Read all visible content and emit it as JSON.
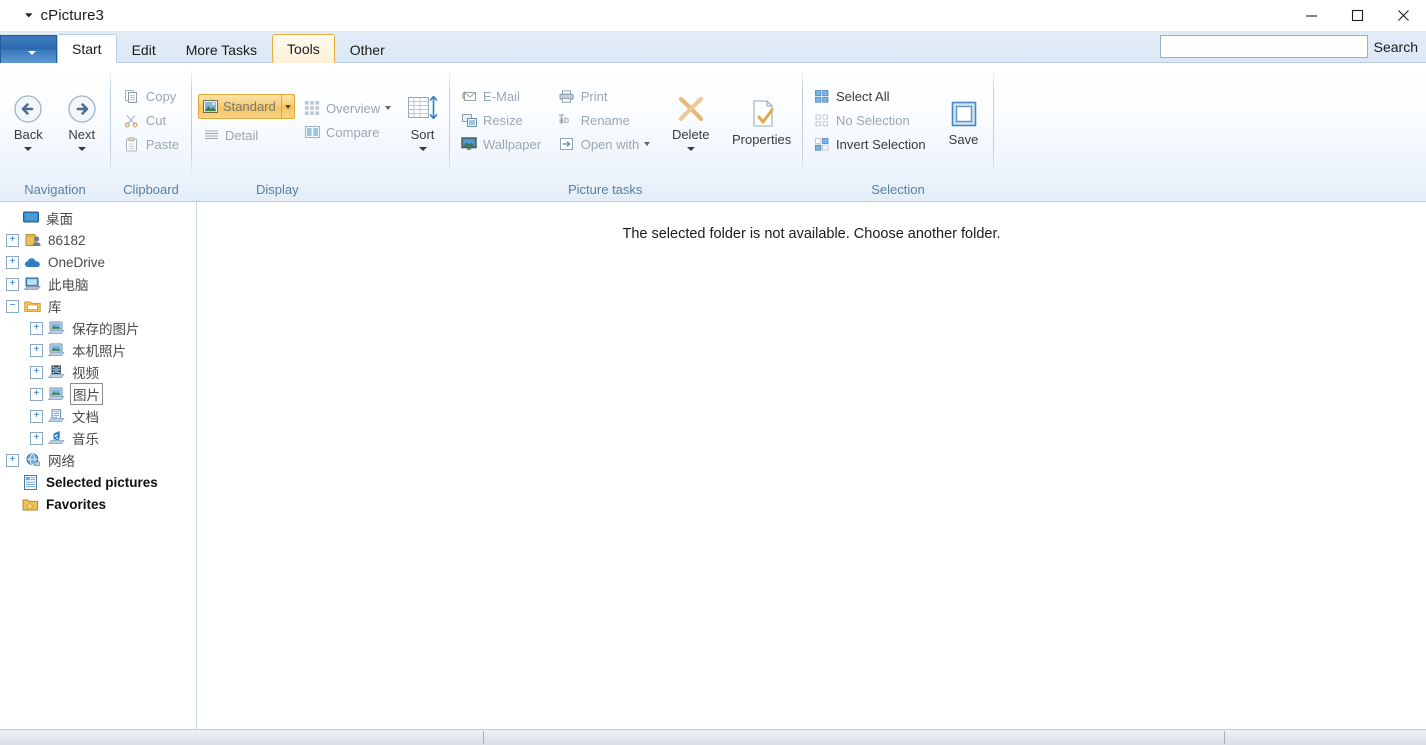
{
  "window": {
    "title": "cPicture3",
    "title_dropdown_icon": "caret-down-icon",
    "controls": {
      "minimize": "minimize-icon",
      "maximize": "maximize-icon",
      "close": "close-icon"
    }
  },
  "tabstrip": {
    "app_menu_label": "",
    "app_menu_icon": "app-menu-caret-icon",
    "tabs": [
      {
        "label": "Start",
        "state": "active"
      },
      {
        "label": "Edit",
        "state": "normal"
      },
      {
        "label": "More Tasks",
        "state": "normal"
      },
      {
        "label": "Tools",
        "state": "hover"
      },
      {
        "label": "Other",
        "state": "normal"
      }
    ],
    "search": {
      "value": "",
      "placeholder": "",
      "label": "Search"
    }
  },
  "ribbon": {
    "groups": [
      {
        "label": "Navigation",
        "big_buttons": [
          {
            "label": "Back",
            "icon": "back-arrow-icon",
            "has_caret": true
          },
          {
            "label": "Next",
            "icon": "forward-arrow-icon",
            "has_caret": true
          }
        ]
      },
      {
        "label": "Clipboard",
        "items": [
          {
            "label": "Copy",
            "icon": "copy-icon",
            "enabled": false
          },
          {
            "label": "Cut",
            "icon": "scissors-icon",
            "enabled": false
          },
          {
            "label": "Paste",
            "icon": "clipboard-icon",
            "enabled": false
          }
        ]
      },
      {
        "label": "Display",
        "toggle": {
          "label": "Standard",
          "icon": "picture-icon",
          "checked": true,
          "has_caret": true
        },
        "items": [
          {
            "label": "Detail",
            "icon": "list-icon",
            "enabled": false
          },
          {
            "label": "Overview",
            "icon": "grid-icon",
            "enabled": false,
            "has_caret": true
          },
          {
            "label": "Compare",
            "icon": "compare-icon",
            "enabled": false
          }
        ],
        "sort_button": {
          "label": "Sort",
          "icon": "sort-icon",
          "has_caret": true
        }
      },
      {
        "label": "Picture tasks",
        "items": [
          {
            "label": "E-Mail",
            "icon": "email-icon",
            "enabled": false
          },
          {
            "label": "Resize",
            "icon": "resize-icon",
            "enabled": false
          },
          {
            "label": "Wallpaper",
            "icon": "wallpaper-icon",
            "enabled": false
          },
          {
            "label": "Print",
            "icon": "printer-icon",
            "enabled": false
          },
          {
            "label": "Rename",
            "icon": "rename-icon",
            "enabled": false
          },
          {
            "label": "Open with",
            "icon": "open-with-icon",
            "enabled": false,
            "has_caret": true
          }
        ],
        "big_buttons": [
          {
            "label": "Delete",
            "icon": "delete-x-icon",
            "has_caret": true
          },
          {
            "label": "Properties",
            "icon": "properties-icon",
            "has_caret": false
          }
        ]
      },
      {
        "label": "Selection",
        "items": [
          {
            "label": "Select All",
            "icon": "select-all-icon",
            "enabled": true
          },
          {
            "label": "No Selection",
            "icon": "no-selection-icon",
            "enabled": false
          },
          {
            "label": "Invert Selection",
            "icon": "invert-selection-icon",
            "enabled": true
          }
        ],
        "big_buttons": [
          {
            "label": "Save",
            "icon": "save-frame-icon",
            "has_caret": false
          }
        ]
      }
    ]
  },
  "sidebar": {
    "nodes": [
      {
        "label": "桌面",
        "indent": 0,
        "expander": "none",
        "icon": "desktop-icon",
        "bold": false,
        "focused": false
      },
      {
        "label": "86182",
        "indent": 0,
        "expander": "plus",
        "icon": "user-folder-icon",
        "bold": false,
        "focused": false
      },
      {
        "label": "OneDrive",
        "indent": 0,
        "expander": "plus",
        "icon": "cloud-icon",
        "bold": false,
        "focused": false
      },
      {
        "label": "此电脑",
        "indent": 0,
        "expander": "plus",
        "icon": "this-pc-icon",
        "bold": false,
        "focused": false
      },
      {
        "label": "库",
        "indent": 0,
        "expander": "minus",
        "icon": "library-icon",
        "bold": false,
        "focused": false
      },
      {
        "label": "保存的图片",
        "indent": 1,
        "expander": "plus",
        "icon": "pictures-lib-icon",
        "bold": false,
        "focused": false
      },
      {
        "label": "本机照片",
        "indent": 1,
        "expander": "plus",
        "icon": "pictures-lib-icon",
        "bold": false,
        "focused": false
      },
      {
        "label": "视频",
        "indent": 1,
        "expander": "plus",
        "icon": "video-lib-icon",
        "bold": false,
        "focused": false
      },
      {
        "label": "图片",
        "indent": 1,
        "expander": "plus",
        "icon": "pictures-lib-icon",
        "bold": false,
        "focused": true
      },
      {
        "label": "文档",
        "indent": 1,
        "expander": "plus",
        "icon": "documents-lib-icon",
        "bold": false,
        "focused": false
      },
      {
        "label": "音乐",
        "indent": 1,
        "expander": "plus",
        "icon": "music-lib-icon",
        "bold": false,
        "focused": false
      },
      {
        "label": "网络",
        "indent": 0,
        "expander": "plus",
        "icon": "network-icon",
        "bold": false,
        "focused": false
      },
      {
        "label": "Selected pictures",
        "indent": 0,
        "expander": "none",
        "icon": "selected-pictures-icon",
        "bold": true,
        "focused": false
      },
      {
        "label": "Favorites",
        "indent": 0,
        "expander": "none",
        "icon": "favorites-icon",
        "bold": true,
        "focused": false
      }
    ]
  },
  "content": {
    "message": "The selected folder is not available. Choose another folder."
  },
  "statusbar": {
    "panels": [
      "",
      "",
      ""
    ]
  },
  "colors": {
    "accent_blue": "#2c68ad",
    "ribbon_bg": "#eaf2fb",
    "tab_strip_bg": "#dce8f6",
    "group_label": "#5b7f9e",
    "toggle_orange": "#f5c35c",
    "tab_hover_border": "#e9ad42",
    "tree_text": "#4a4a4a",
    "disabled_text": "#9aa7b3"
  }
}
